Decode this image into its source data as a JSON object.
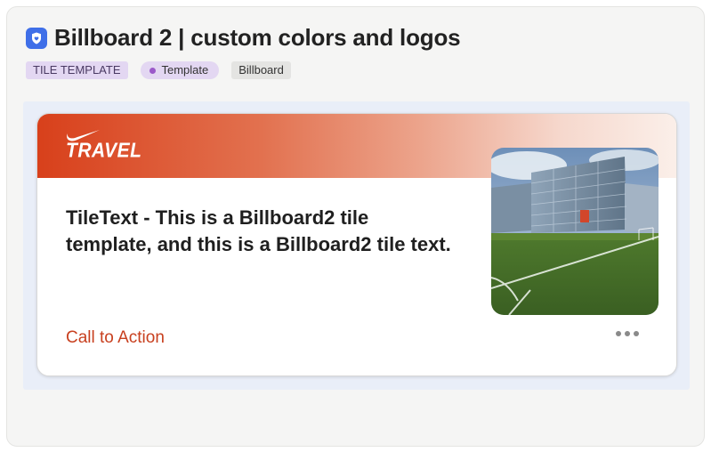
{
  "header": {
    "title": "Billboard 2 | custom colors and logos",
    "app_icon": "shield-heart-icon"
  },
  "tags": {
    "type_label": "TILE TEMPLATE",
    "status_label": "Template",
    "category_label": "Billboard"
  },
  "tile": {
    "logo_text": "TRAVEL",
    "logo_icon": "swoosh-icon",
    "text": "TileText - This is a Billboard2 tile template, and this is a Billboard2 tile text.",
    "cta_label": "Call to Action",
    "more_icon": "more-horizontal-icon",
    "image": "office-building-and-sports-field-photo"
  },
  "colors": {
    "accent": "#d8401b",
    "cta": "#c8401f",
    "tag_purple": "#e3d7f2",
    "status_dot": "#9b59c9",
    "app_icon_blue": "#3f6fe8"
  }
}
